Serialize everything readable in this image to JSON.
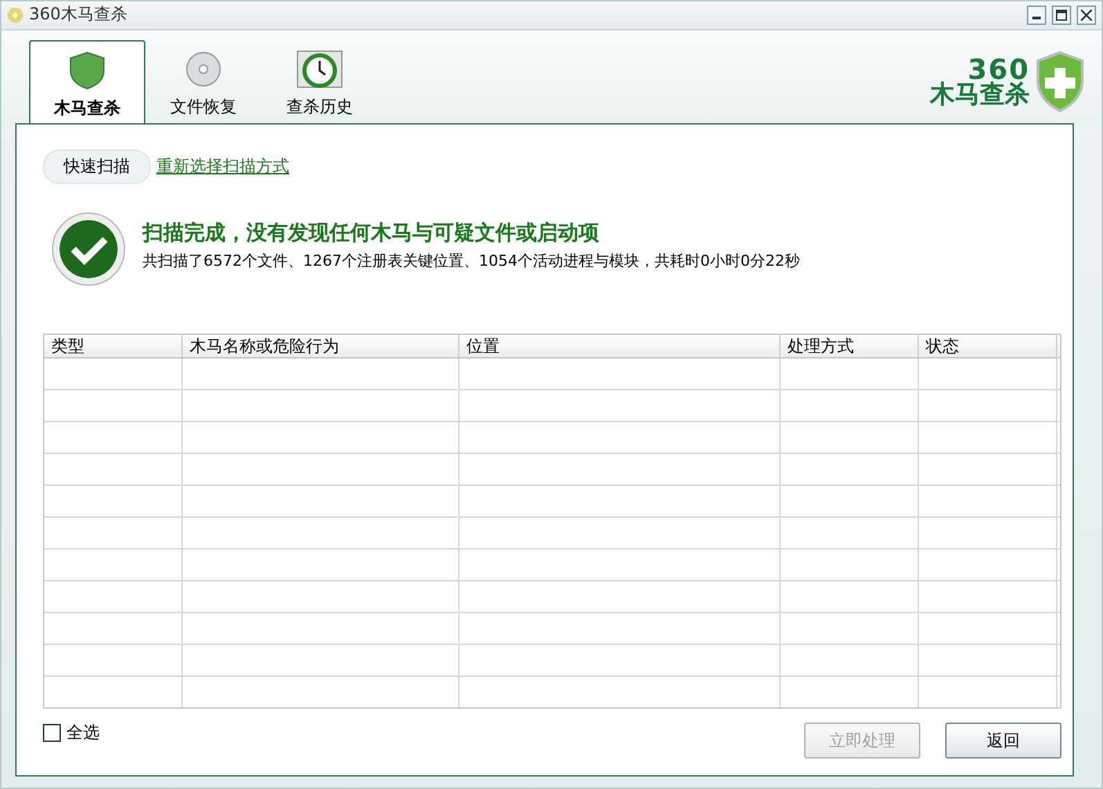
{
  "window": {
    "title": "360木马查杀"
  },
  "tabs": [
    {
      "label": "木马查杀",
      "selected": true
    },
    {
      "label": "文件恢复",
      "selected": false
    },
    {
      "label": "查杀历史",
      "selected": false
    }
  ],
  "logo": {
    "number": "360",
    "name": "木马查杀"
  },
  "scan_mode": {
    "button": "快速扫描",
    "link": "重新选择扫描方式"
  },
  "result": {
    "title": "扫描完成，没有发现任何木马与可疑文件或启动项",
    "summary": "共扫描了6572个文件、1267个注册表关键位置、1054个活动进程与模块，共耗时0小时0分22秒"
  },
  "table": {
    "columns": [
      "类型",
      "木马名称或危险行为",
      "位置",
      "处理方式",
      "状态"
    ]
  },
  "select_all": {
    "label": "全选",
    "checked": false
  },
  "buttons": [
    {
      "label": "立即处理",
      "disabled": true
    },
    {
      "label": "返回",
      "disabled": false
    }
  ]
}
